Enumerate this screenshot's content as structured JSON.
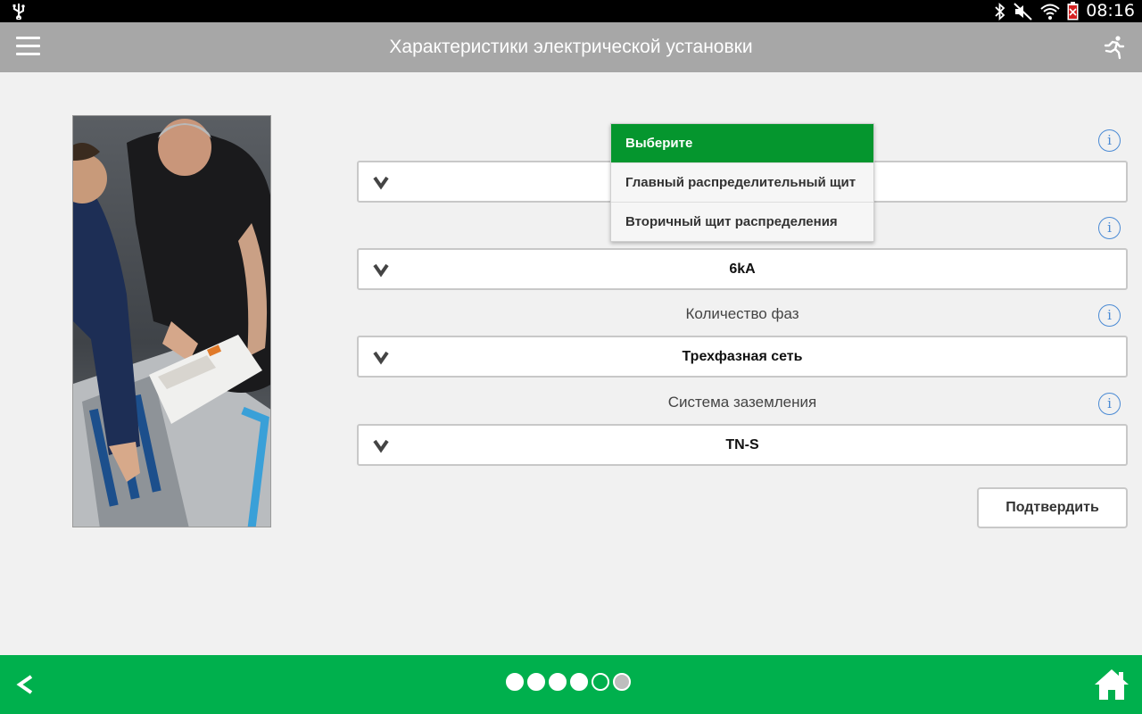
{
  "status_bar": {
    "time": "08:16",
    "icons": [
      "usb-icon",
      "bluetooth-icon",
      "mute-icon",
      "wifi-icon",
      "battery-icon"
    ]
  },
  "app_bar": {
    "title": "Характеристики электрической установки",
    "menu_icon": "hamburger-menu-icon",
    "exit_icon": "running-man-exit-icon"
  },
  "form": {
    "fields": [
      {
        "label": "",
        "value": ""
      },
      {
        "label": "",
        "value": "6kA"
      },
      {
        "label": "Количество фаз",
        "value": "Трехфазная сеть"
      },
      {
        "label": "Система заземления",
        "value": "TN-S"
      }
    ],
    "info_icon": "info-icon",
    "chevron_icon": "chevron-down-icon",
    "confirm_label": "Подтвердить"
  },
  "dropdown": {
    "selected_index": 0,
    "options": [
      "Выберите",
      "Главный распределительный щит",
      "Вторичный щит распределения"
    ]
  },
  "bottom_bar": {
    "back_icon": "back-arrow-icon",
    "home_icon": "home-icon",
    "pager": {
      "total": 6,
      "current": 6
    }
  },
  "colors": {
    "app_bar": "#a7a7a7",
    "bottom_bar": "#00b04d",
    "selected_option": "#05962e",
    "info_blue": "#4a8ad4"
  }
}
